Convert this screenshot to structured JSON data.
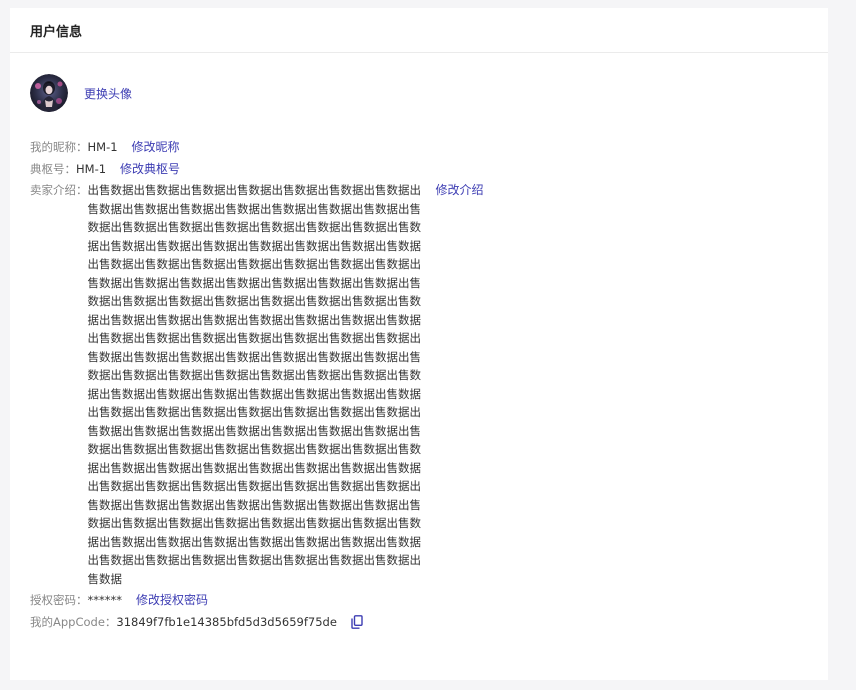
{
  "header": {
    "title": "用户信息"
  },
  "avatar": {
    "change_label": "更换头像"
  },
  "profile": {
    "nickname_label": "我的昵称：",
    "nickname_value": "HM-1",
    "nickname_edit": "修改昵称",
    "dianshu_label": "典枢号：",
    "dianshu_value": "HM-1",
    "dianshu_edit": "修改典枢号",
    "intro_label": "卖家介绍：",
    "intro_value": "出售数据出售数据出售数据出售数据出售数据出售数据出售数据出售数据出售数据出售数据出售数据出售数据出售数据出售数据出售数据出售数据出售数据出售数据出售数据出售数据出售数据出售数据出售数据出售数据出售数据出售数据出售数据出售数据出售数据出售数据出售数据出售数据出售数据出售数据出售数据出售数据出售数据出售数据出售数据出售数据出售数据出售数据出售数据出售数据出售数据出售数据出售数据出售数据出售数据出售数据出售数据出售数据出售数据出售数据出售数据出售数据出售数据出售数据出售数据出售数据出售数据出售数据出售数据出售数据出售数据出售数据出售数据出售数据出售数据出售数据出售数据出售数据出售数据出售数据出售数据出售数据出售数据出售数据出售数据出售数据出售数据出售数据出售数据出售数据出售数据出售数据出售数据出售数据出售数据出售数据出售数据出售数据出售数据出售数据出售数据出售数据出售数据出售数据出售数据出售数据出售数据出售数据出售数据出售数据出售数据出售数据出售数据出售数据出售数据出售数据出售数据出售数据出售数据出售数据出售数据出售数据出售数据出售数据出售数据出售数据出售数据出售数据出售数据出售数据出售数据出售数据出售数据出售数据出售数据出售数据出售数据出售数据出售数据出售数据出售数据出售数据出售数据出售数据出售数据出售数据出售数据出售数据出售数据出售数据出售数据出售数据出售数据出售数据出售数据出售数据出售数据出售数据出售数据",
    "intro_edit": "修改介绍",
    "password_label": "授权密码：",
    "password_value": "******",
    "password_edit": "修改授权密码",
    "appcode_label": "我的AppCode：",
    "appcode_value": "31849f7fb1e14385bfd5d3d5659f75de"
  },
  "icons": {
    "copy": "copy-icon"
  },
  "colors": {
    "link": "#3d3db3",
    "label": "#888888",
    "background": "#f5f5f7"
  }
}
